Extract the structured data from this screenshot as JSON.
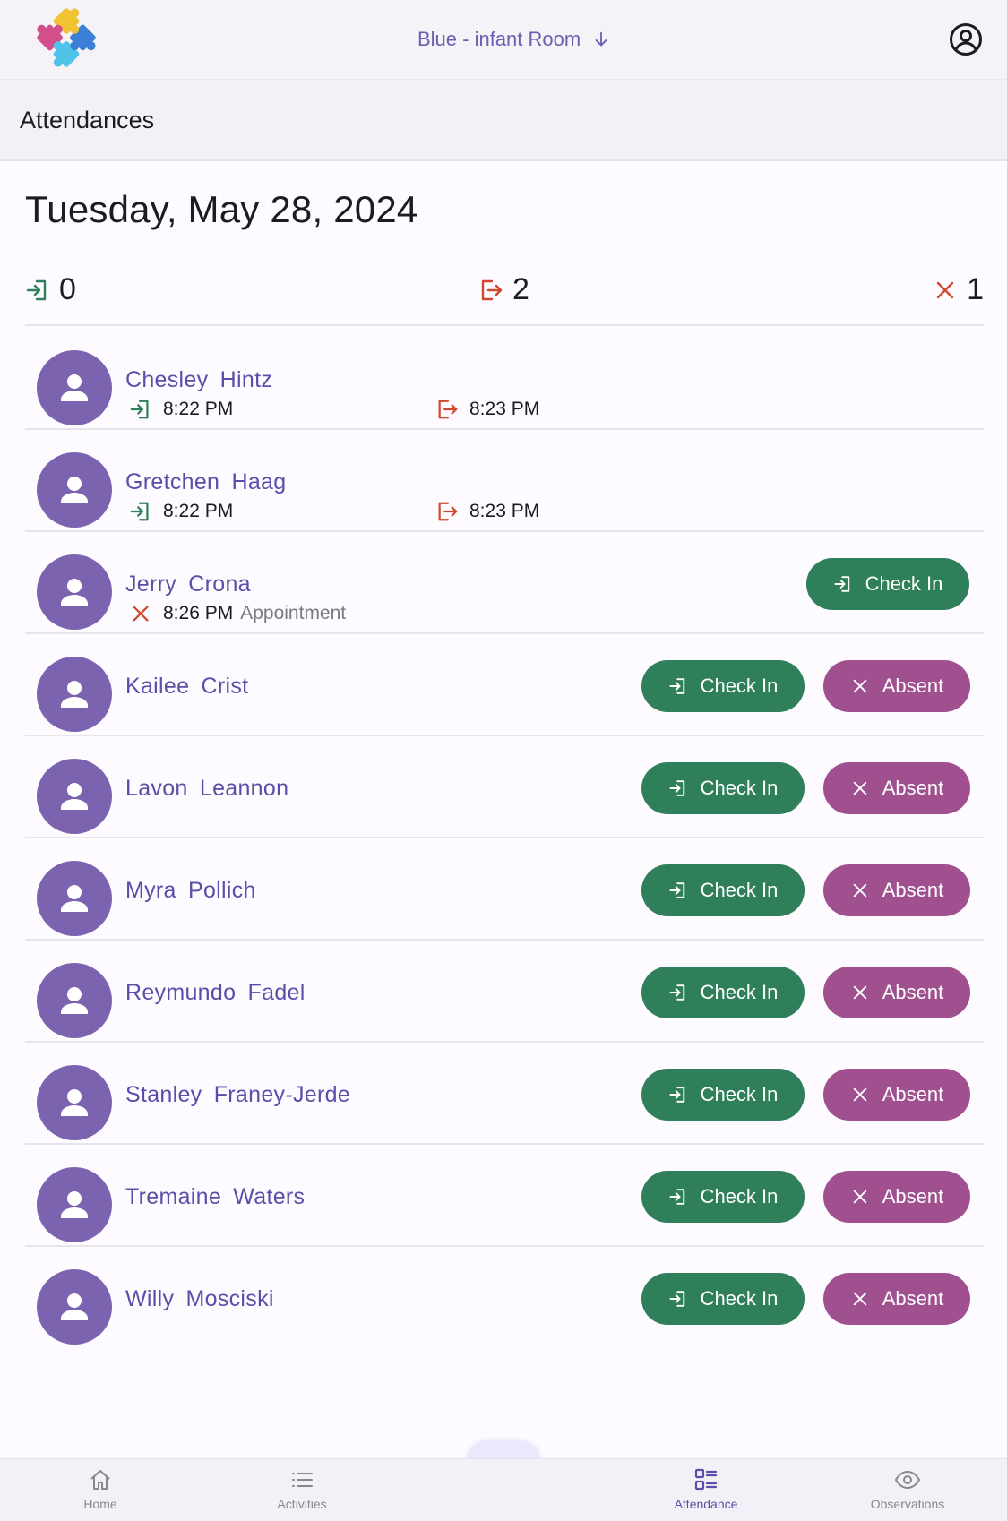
{
  "header": {
    "room_label": "Blue - infant Room"
  },
  "page": {
    "title": "Attendances",
    "date": "Tuesday, May 28, 2024"
  },
  "counts": {
    "checked_in": "0",
    "checked_out": "2",
    "absent": "1"
  },
  "colors": {
    "primary": "#5b4ea8",
    "avatar": "#7c63b0",
    "check_in_green": "#2f7f5b",
    "absent_magenta": "#a04f8f",
    "check_out_red": "#d0492c"
  },
  "buttons": {
    "check_in": "Check In",
    "absent": "Absent"
  },
  "children": [
    {
      "name": "Chesley  Hintz",
      "status": "checked_out",
      "in_time": "8:22 PM",
      "out_time": "8:23 PM"
    },
    {
      "name": "Gretchen  Haag",
      "status": "checked_out",
      "in_time": "8:22 PM",
      "out_time": "8:23 PM"
    },
    {
      "name": "Jerry  Crona",
      "status": "absent",
      "absent_time": "8:26 PM",
      "absent_note": "Appointment"
    },
    {
      "name": "Kailee  Crist",
      "status": "pending"
    },
    {
      "name": "Lavon  Leannon",
      "status": "pending"
    },
    {
      "name": "Myra  Pollich",
      "status": "pending"
    },
    {
      "name": "Reymundo  Fadel",
      "status": "pending"
    },
    {
      "name": "Stanley  Franey-Jerde",
      "status": "pending"
    },
    {
      "name": "Tremaine  Waters",
      "status": "pending"
    },
    {
      "name": "Willy  Mosciski",
      "status": "pending"
    }
  ],
  "nav": {
    "home": "Home",
    "activities": "Activities",
    "attendance": "Attendance",
    "observations": "Observations",
    "active": "attendance"
  }
}
